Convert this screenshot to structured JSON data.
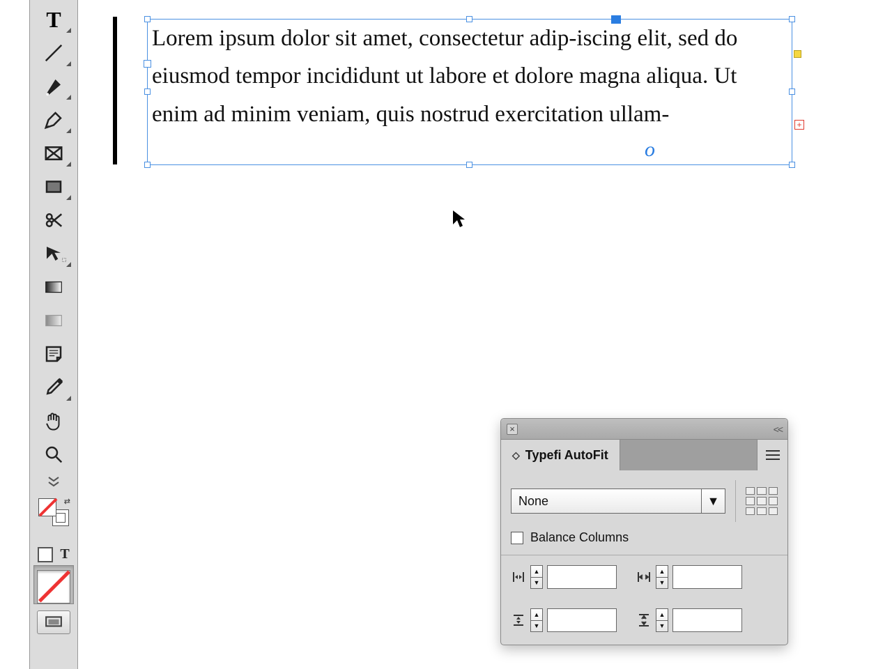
{
  "textframe": {
    "content": "Lorem ipsum dolor sit amet, consectetur adip-iscing elit, sed do eiusmod tempor incididunt ut labore et dolore magna aliqua. Ut enim ad minim veniam, quis nostrud exercitation ullam-"
  },
  "toolbar": {
    "tools": [
      "type-tool",
      "line-tool",
      "pen-tool",
      "pencil-tool",
      "rectangle-frame-tool",
      "rectangle-tool",
      "scissors-tool",
      "free-transform-tool",
      "gradient-swatch-tool",
      "gradient-feather-tool",
      "note-tool",
      "eyedropper-tool",
      "hand-tool",
      "zoom-tool"
    ]
  },
  "panel": {
    "title": "Typefi AutoFit",
    "dropdown_value": "None",
    "balance_label": "Balance Columns",
    "balance_checked": false,
    "fields": {
      "min_width": "",
      "max_width": "",
      "min_height": "",
      "max_height": ""
    }
  },
  "overflow_marker": "+"
}
